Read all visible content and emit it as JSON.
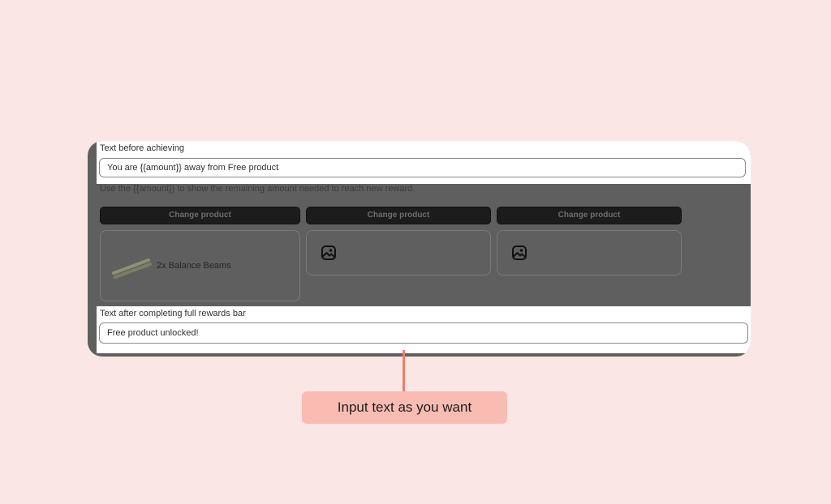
{
  "settings": {
    "before_label": "Text before achieving",
    "before_value": "You are {{amount}} away from Free product",
    "help_text": "Use the {{amount}} to show the remaining amount needed to reach new reward.",
    "change_product_label": "Change product",
    "products": [
      {
        "title": "2x Balance Beams",
        "icon": "balance-beam-image"
      },
      {
        "title": "",
        "icon": "image-placeholder-icon"
      },
      {
        "title": "",
        "icon": "image-placeholder-icon"
      }
    ],
    "after_label": "Text after completing full rewards bar",
    "after_value": "Free product unlocked!"
  },
  "callout": {
    "text": "Input text as you want"
  },
  "colors": {
    "background": "#fbe6e6",
    "overlay": "#5f5f5f",
    "callout": "#f9bcb3",
    "callout_line": "#f27b6b"
  }
}
